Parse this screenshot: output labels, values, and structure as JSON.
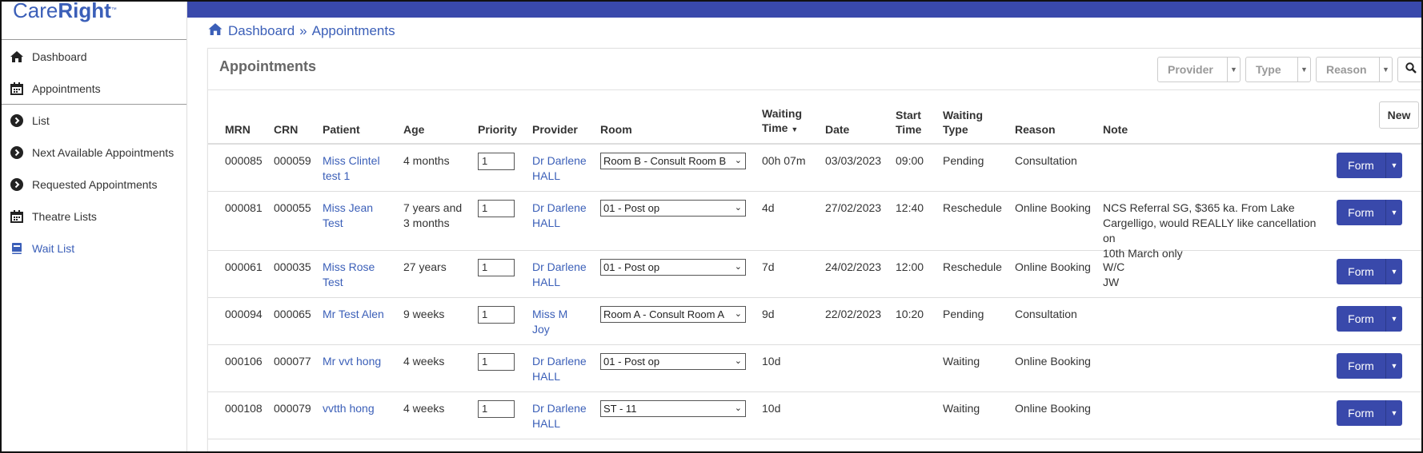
{
  "app": {
    "logo_care": "Care",
    "logo_right": "Right",
    "logo_tm": "™"
  },
  "sidebar": {
    "items": [
      {
        "label": "Dashboard",
        "icon": "home-icon"
      },
      {
        "label": "Appointments",
        "icon": "calendar-icon"
      },
      {
        "label": "List",
        "icon": "chevron-circle-icon"
      },
      {
        "label": "Next Available Appointments",
        "icon": "chevron-circle-icon"
      },
      {
        "label": "Requested Appointments",
        "icon": "chevron-circle-icon"
      },
      {
        "label": "Theatre Lists",
        "icon": "calendar-icon"
      },
      {
        "label": "Wait List",
        "icon": "book-icon"
      }
    ]
  },
  "breadcrumb": {
    "home": "Dashboard",
    "separator": "»",
    "current": "Appointments"
  },
  "panel": {
    "title": "Appointments",
    "filters": {
      "provider": "Provider",
      "type": "Type",
      "reason": "Reason"
    },
    "new_label": "New"
  },
  "table": {
    "headers": {
      "mrn": "MRN",
      "crn": "CRN",
      "patient": "Patient",
      "age": "Age",
      "priority": "Priority",
      "provider": "Provider",
      "room": "Room",
      "waiting_time_1": "Waiting",
      "waiting_time_2": "Time",
      "date": "Date",
      "start_time_1": "Start",
      "start_time_2": "Time",
      "waiting_type_1": "Waiting",
      "waiting_type_2": "Type",
      "reason": "Reason",
      "note": "Note"
    },
    "form_label": "Form",
    "rows": [
      {
        "mrn": "000085",
        "crn": "000059",
        "patient_1": "Miss Clintel",
        "patient_2": "test 1",
        "age_1": "4 months",
        "age_2": "",
        "priority": "1",
        "provider_1": "Dr Darlene",
        "provider_2": "HALL",
        "room": "Room B - Consult Room B",
        "waiting_time": "00h 07m",
        "date": "03/03/2023",
        "start_time": "09:00",
        "waiting_type": "Pending",
        "reason": "Consultation",
        "note_1": "",
        "note_2": "",
        "note_3": ""
      },
      {
        "mrn": "000081",
        "crn": "000055",
        "patient_1": "Miss Jean",
        "patient_2": "Test",
        "age_1": "7 years and",
        "age_2": "3 months",
        "priority": "1",
        "provider_1": "Dr Darlene",
        "provider_2": "HALL",
        "room": "01 - Post op",
        "waiting_time": "4d",
        "date": "27/02/2023",
        "start_time": "12:40",
        "waiting_type": "Reschedule",
        "reason": "Online Booking",
        "note_1": "NCS Referral SG, $365   ka. From Lake",
        "note_2": "Cargelligo, would REALLY like cancellation on",
        "note_3": "10th March only"
      },
      {
        "mrn": "000061",
        "crn": "000035",
        "patient_1": "Miss Rose",
        "patient_2": "Test",
        "age_1": "27 years",
        "age_2": "",
        "priority": "1",
        "provider_1": "Dr Darlene",
        "provider_2": "HALL",
        "room": "01 - Post op",
        "waiting_time": "7d",
        "date": "24/02/2023",
        "start_time": "12:00",
        "waiting_type": "Reschedule",
        "reason": "Online Booking",
        "note_1": "W/C",
        "note_2": "JW",
        "note_3": ""
      },
      {
        "mrn": "000094",
        "crn": "000065",
        "patient_1": "Mr Test Alen",
        "patient_2": "",
        "age_1": "9 weeks",
        "age_2": "",
        "priority": "1",
        "provider_1": "Miss M",
        "provider_2": "Joy",
        "room": "Room A - Consult Room A",
        "waiting_time": "9d",
        "date": "22/02/2023",
        "start_time": "10:20",
        "waiting_type": "Pending",
        "reason": "Consultation",
        "note_1": "",
        "note_2": "",
        "note_3": ""
      },
      {
        "mrn": "000106",
        "crn": "000077",
        "patient_1": "Mr vvt hong",
        "patient_2": "",
        "age_1": "4 weeks",
        "age_2": "",
        "priority": "1",
        "provider_1": "Dr Darlene",
        "provider_2": "HALL",
        "room": "01 - Post op",
        "waiting_time": "10d",
        "date": "",
        "start_time": "",
        "waiting_type": "Waiting",
        "reason": "Online Booking",
        "note_1": "",
        "note_2": "",
        "note_3": ""
      },
      {
        "mrn": "000108",
        "crn": "000079",
        "patient_1": "vvtth hong",
        "patient_2": "",
        "age_1": "4 weeks",
        "age_2": "",
        "priority": "1",
        "provider_1": "Dr Darlene",
        "provider_2": "HALL",
        "room": "ST - 11",
        "waiting_time": "10d",
        "date": "",
        "start_time": "",
        "waiting_type": "Waiting",
        "reason": "Online Booking",
        "note_1": "",
        "note_2": "",
        "note_3": ""
      }
    ]
  },
  "colors": {
    "primary": "#3949ab",
    "link": "#3b5fb8"
  }
}
